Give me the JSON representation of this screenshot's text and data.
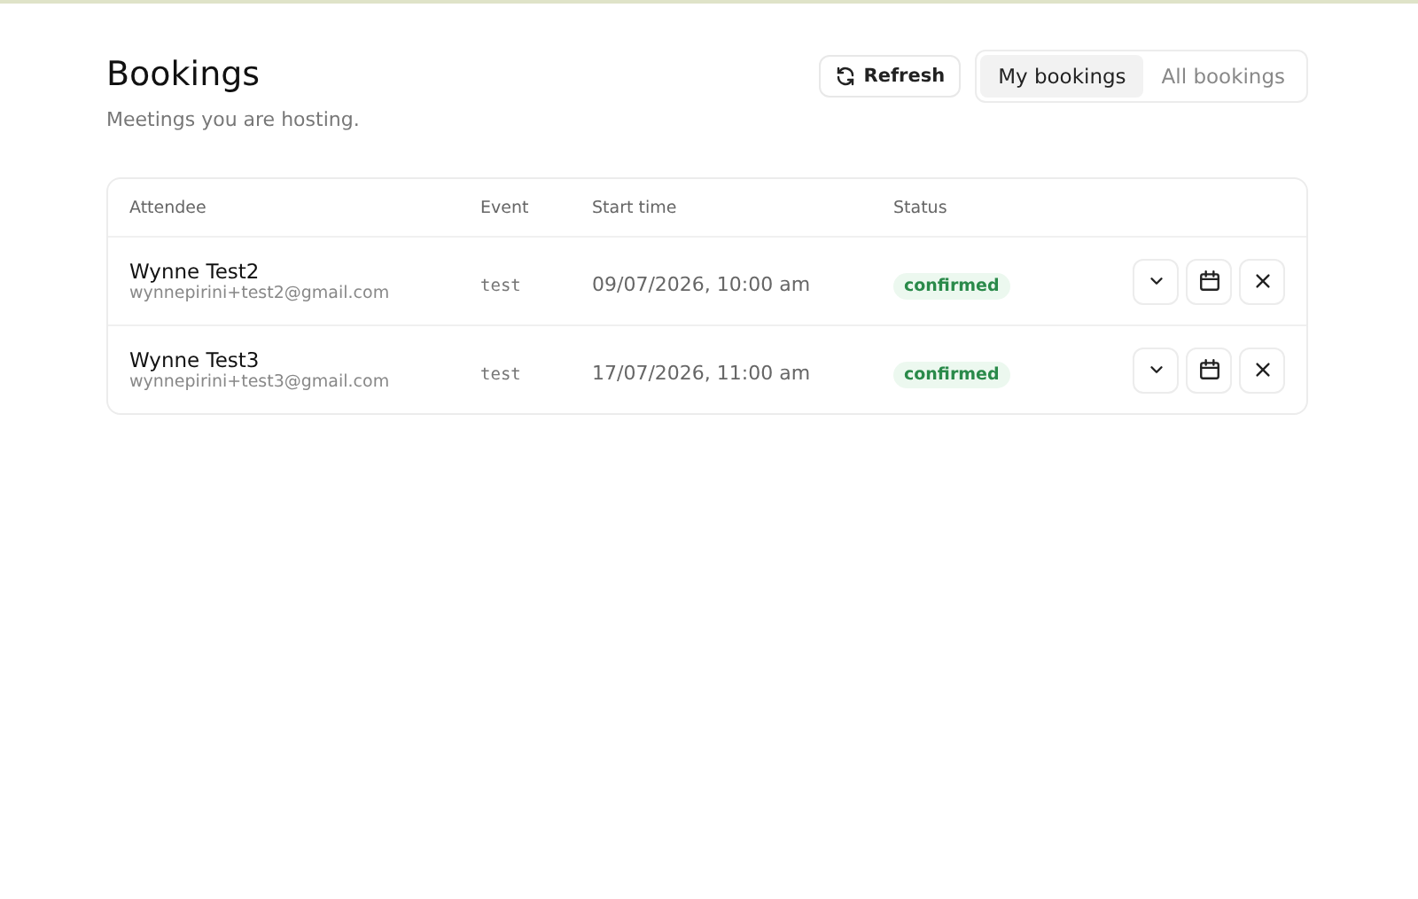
{
  "header": {
    "title": "Bookings",
    "subtitle": "Meetings you are hosting."
  },
  "refresh_button": {
    "label": "Refresh"
  },
  "tabs": [
    {
      "label": "My bookings",
      "selected": true
    },
    {
      "label": "All bookings",
      "selected": false
    }
  ],
  "table": {
    "columns": [
      "Attendee",
      "Event",
      "Start time",
      "Status"
    ],
    "rows": [
      {
        "name": "Wynne Test2",
        "email": "wynnepirini+test2@gmail.com",
        "event": "test",
        "start_time": "09/07/2026, 10:00 am",
        "status": {
          "label": "confirmed",
          "kind": "confirmed"
        }
      },
      {
        "name": "Wynne Test3",
        "email": "wynnepirini+test3@gmail.com",
        "event": "test",
        "start_time": "17/07/2026, 11:00 am",
        "status": {
          "label": "confirmed",
          "kind": "confirmed"
        }
      }
    ]
  }
}
